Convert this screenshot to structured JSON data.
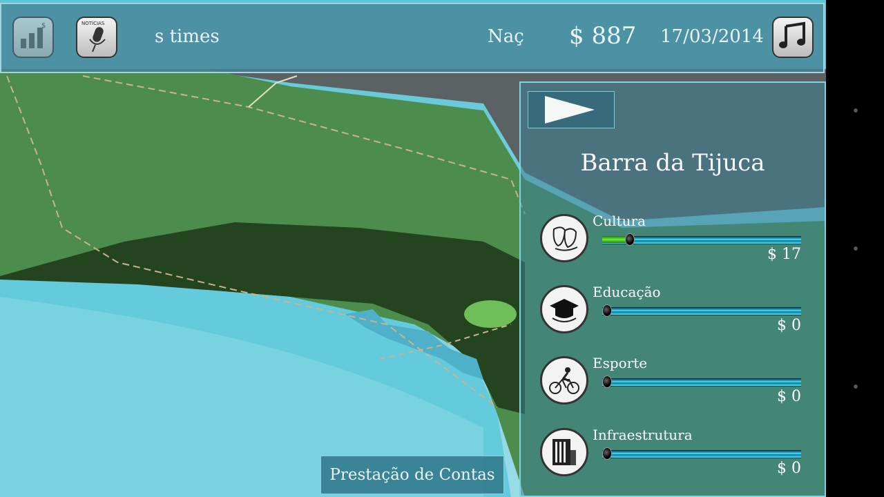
{
  "topbar": {
    "ticker_text": "s times",
    "nation_text": "Naç",
    "money": "$ 887",
    "date": "17/03/2014",
    "news_icon_label": "NOTÍCIAS"
  },
  "panel": {
    "region_name": "Barra da Tijuca",
    "categories": [
      {
        "label": "Cultura",
        "value": "$ 17",
        "level": 0.13,
        "icon": "theater-masks-icon"
      },
      {
        "label": "Educação",
        "value": "$ 0",
        "level": 0.0,
        "icon": "graduation-cap-icon"
      },
      {
        "label": "Esporte",
        "value": "$ 0",
        "level": 0.0,
        "icon": "cyclist-icon"
      },
      {
        "label": "Infraestrutura",
        "value": "$ 0",
        "level": 0.0,
        "icon": "building-icon"
      }
    ]
  },
  "footer": {
    "accounts_button": "Prestação de Contas"
  },
  "colors": {
    "slider_track": "#47e8ff",
    "slider_fill": "#6cf03a",
    "panel_border": "#7fd4e4"
  }
}
